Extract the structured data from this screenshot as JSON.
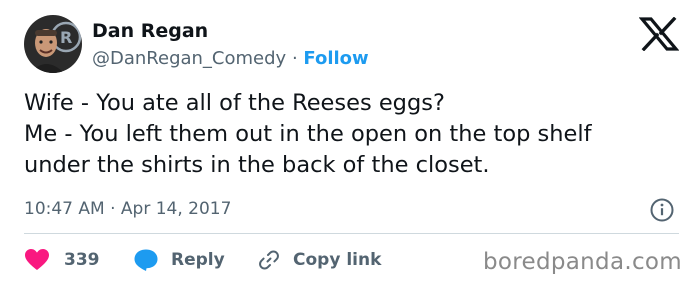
{
  "author": {
    "name": "Dan Regan",
    "handle": "@DanRegan_Comedy",
    "separator": "·",
    "follow_label": "Follow",
    "avatar_icon": "profile-photo"
  },
  "tweet": {
    "lines": [
      "Wife - You ate all of the Reeses eggs?",
      "Me - You left them out in the open on the top shelf",
      "under the shirts in the back of the closet."
    ],
    "time": "10:47 AM",
    "date_separator": "·",
    "date": "Apr 14, 2017"
  },
  "actions": {
    "like_count": "339",
    "reply_label": "Reply",
    "copy_label": "Copy link"
  },
  "watermark": "boredpanda.com",
  "colors": {
    "like": "#f91880",
    "reply": "#1d9bf0",
    "follow": "#1d9bf0",
    "muted": "#536471",
    "text": "#0f1419"
  }
}
